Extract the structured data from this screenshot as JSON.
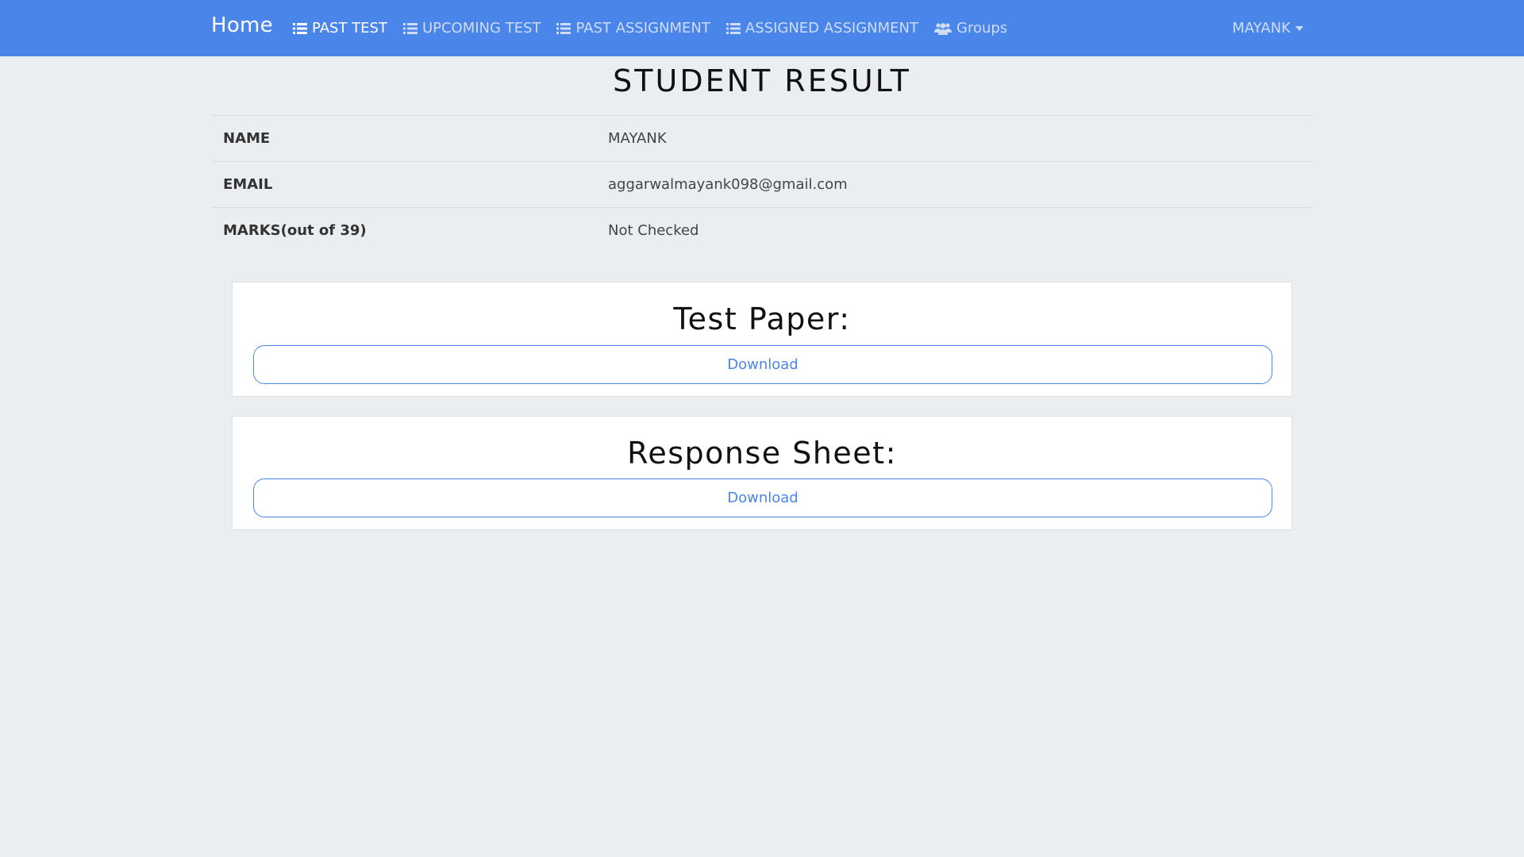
{
  "navbar": {
    "brand": "Home",
    "links": [
      {
        "label": "PAST TEST",
        "icon": "list-icon",
        "active": true
      },
      {
        "label": "UPCOMING TEST",
        "icon": "list-icon",
        "active": false
      },
      {
        "label": "PAST ASSIGNMENT",
        "icon": "list-icon",
        "active": false
      },
      {
        "label": "ASSIGNED ASSIGNMENT",
        "icon": "list-icon",
        "active": false
      },
      {
        "label": "Groups",
        "icon": "users-icon",
        "active": false
      }
    ],
    "user": "MAYANK",
    "color": "#4a85ea"
  },
  "page": {
    "title": "STUDENT RESULT"
  },
  "result": {
    "rows": [
      {
        "label": "NAME",
        "value": "MAYANK"
      },
      {
        "label": "EMAIL",
        "value": "aggarwalmayank098@gmail.com"
      },
      {
        "label": "MARKS(out of 39)",
        "value": "Not Checked"
      }
    ]
  },
  "cards": {
    "test_paper": {
      "title": "Test Paper:",
      "button": "Download"
    },
    "response_sheet": {
      "title": "Response Sheet:",
      "button": "Download"
    }
  }
}
